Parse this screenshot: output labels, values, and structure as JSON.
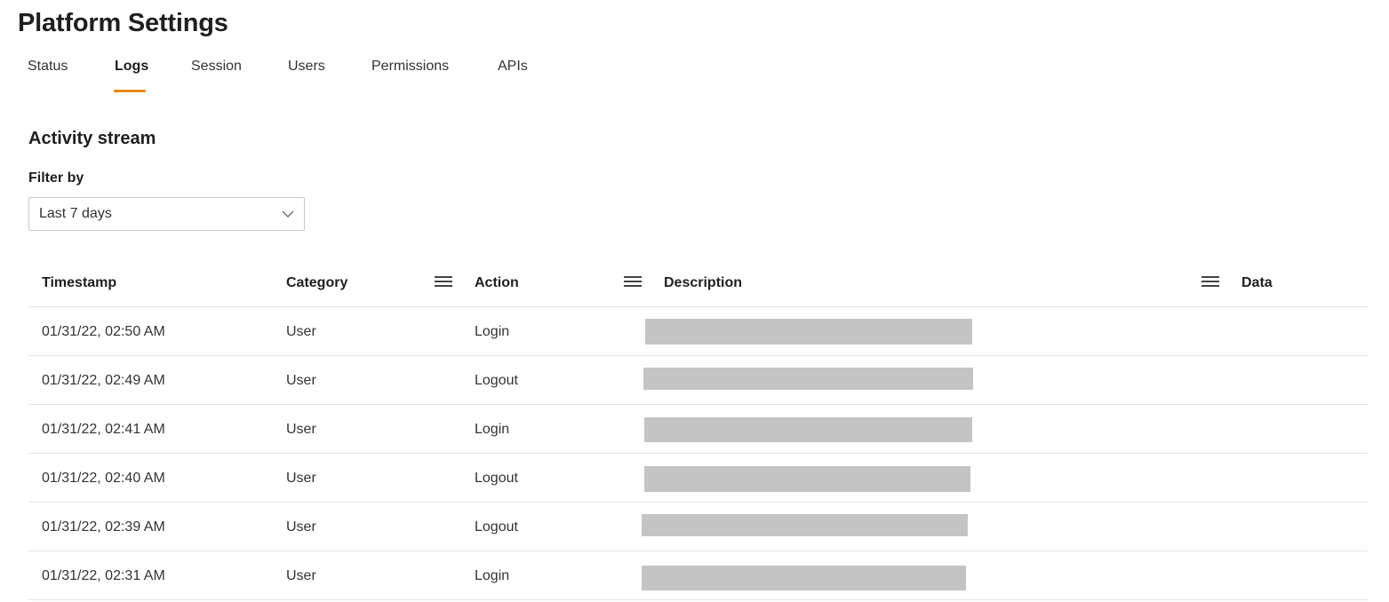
{
  "page": {
    "title": "Platform Settings"
  },
  "tabs": [
    {
      "label": "Status",
      "active": false
    },
    {
      "label": "Logs",
      "active": true
    },
    {
      "label": "Session",
      "active": false
    },
    {
      "label": "Users",
      "active": false
    },
    {
      "label": "Permissions",
      "active": false
    },
    {
      "label": "APIs",
      "active": false
    }
  ],
  "activity": {
    "title": "Activity stream",
    "filter_label": "Filter by",
    "filter_value": "Last 7 days"
  },
  "table": {
    "columns": {
      "timestamp": "Timestamp",
      "category": "Category",
      "action": "Action",
      "description": "Description",
      "data": "Data"
    },
    "rows": [
      {
        "timestamp": "01/31/22, 02:50 AM",
        "category": "User",
        "action": "Login",
        "description_redacted": true
      },
      {
        "timestamp": "01/31/22, 02:49 AM",
        "category": "User",
        "action": "Logout",
        "description_redacted": true
      },
      {
        "timestamp": "01/31/22, 02:41 AM",
        "category": "User",
        "action": "Login",
        "description_redacted": true
      },
      {
        "timestamp": "01/31/22, 02:40 AM",
        "category": "User",
        "action": "Logout",
        "description_redacted": true
      },
      {
        "timestamp": "01/31/22, 02:39 AM",
        "category": "User",
        "action": "Logout",
        "description_redacted": true
      },
      {
        "timestamp": "01/31/22, 02:31 AM",
        "category": "User",
        "action": "Login",
        "description_redacted": true
      }
    ]
  },
  "colors": {
    "accent": "#e8871e",
    "redaction": "#c4c4c4",
    "divider": "#e3e3e3"
  },
  "icons": {
    "filter_dropdown": "chevron-down-icon",
    "column_menu": "column-menu-icon"
  }
}
